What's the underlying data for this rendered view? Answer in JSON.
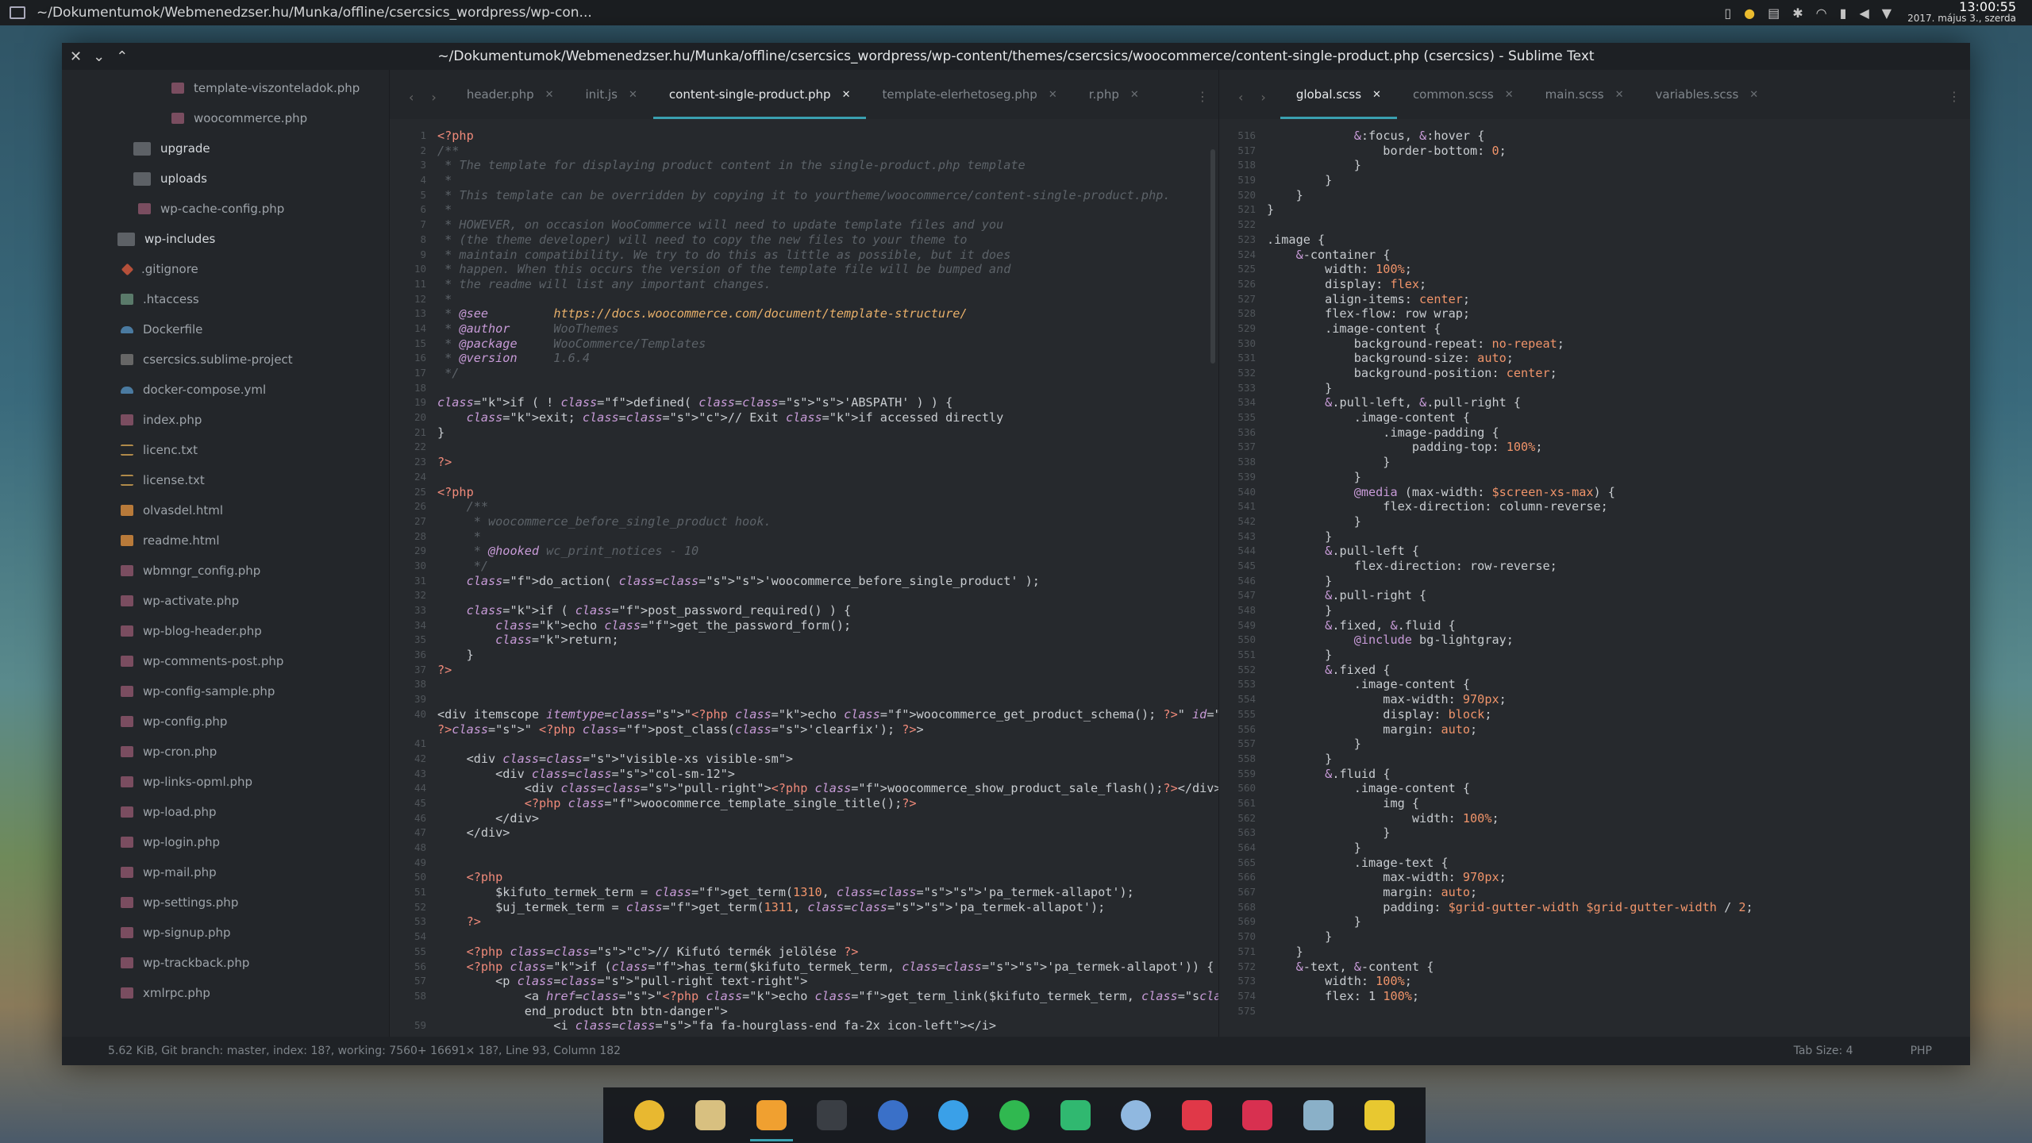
{
  "top_panel": {
    "title": "~/Dokumentumok/Webmenedzser.hu/Munka/offline/csercsics_wordpress/wp-con...",
    "time": "13:00:55",
    "date": "2017. május 3., szerda"
  },
  "window": {
    "title": "~/Dokumentumok/Webmenedzser.hu/Munka/offline/csercsics_wordpress/wp-content/themes/csercsics/woocommerce/content-single-product.php (csercsics) - Sublime Text",
    "close": "✕",
    "minimize": "⌄",
    "maximize": "⌃"
  },
  "sidebar": {
    "items": [
      {
        "label": "template-viszonteladok.php",
        "icon": "php",
        "indent": 120
      },
      {
        "label": "woocommerce.php",
        "icon": "php",
        "indent": 120
      },
      {
        "label": "upgrade",
        "icon": "folder",
        "indent": 72,
        "folder": true
      },
      {
        "label": "uploads",
        "icon": "folder",
        "indent": 72,
        "folder": true
      },
      {
        "label": "wp-cache-config.php",
        "icon": "php",
        "indent": 78
      },
      {
        "label": "wp-includes",
        "icon": "folder",
        "indent": 52,
        "folder": true
      },
      {
        "label": ".gitignore",
        "icon": "git",
        "indent": 56
      },
      {
        "label": ".htaccess",
        "icon": "htaccess",
        "indent": 56
      },
      {
        "label": "Dockerfile",
        "icon": "docker",
        "indent": 56
      },
      {
        "label": "csercsics.sublime-project",
        "icon": "proj",
        "indent": 56
      },
      {
        "label": "docker-compose.yml",
        "icon": "docker",
        "indent": 56
      },
      {
        "label": "index.php",
        "icon": "php",
        "indent": 56
      },
      {
        "label": "licenc.txt",
        "icon": "txt",
        "indent": 56
      },
      {
        "label": "license.txt",
        "icon": "txt",
        "indent": 56
      },
      {
        "label": "olvasdel.html",
        "icon": "html",
        "indent": 56
      },
      {
        "label": "readme.html",
        "icon": "html",
        "indent": 56
      },
      {
        "label": "wbmngr_config.php",
        "icon": "php",
        "indent": 56
      },
      {
        "label": "wp-activate.php",
        "icon": "php",
        "indent": 56
      },
      {
        "label": "wp-blog-header.php",
        "icon": "php",
        "indent": 56
      },
      {
        "label": "wp-comments-post.php",
        "icon": "php",
        "indent": 56
      },
      {
        "label": "wp-config-sample.php",
        "icon": "php",
        "indent": 56
      },
      {
        "label": "wp-config.php",
        "icon": "php",
        "indent": 56
      },
      {
        "label": "wp-cron.php",
        "icon": "php",
        "indent": 56
      },
      {
        "label": "wp-links-opml.php",
        "icon": "php",
        "indent": 56
      },
      {
        "label": "wp-load.php",
        "icon": "php",
        "indent": 56
      },
      {
        "label": "wp-login.php",
        "icon": "php",
        "indent": 56
      },
      {
        "label": "wp-mail.php",
        "icon": "php",
        "indent": 56
      },
      {
        "label": "wp-settings.php",
        "icon": "php",
        "indent": 56
      },
      {
        "label": "wp-signup.php",
        "icon": "php",
        "indent": 56
      },
      {
        "label": "wp-trackback.php",
        "icon": "php",
        "indent": 56
      },
      {
        "label": "xmlrpc.php",
        "icon": "php",
        "indent": 56
      }
    ]
  },
  "left_tabs": [
    {
      "label": "header.php",
      "active": false
    },
    {
      "label": "init.js",
      "active": false
    },
    {
      "label": "content-single-product.php",
      "active": true
    },
    {
      "label": "template-elerhetoseg.php",
      "active": false
    },
    {
      "label": "r.php",
      "active": false
    }
  ],
  "right_tabs": [
    {
      "label": "global.scss",
      "active": true
    },
    {
      "label": "common.scss",
      "active": false
    },
    {
      "label": "main.scss",
      "active": false
    },
    {
      "label": "variables.scss",
      "active": false
    }
  ],
  "left_code": {
    "start_line": 1,
    "lines": [
      "<?php",
      "/**",
      " * The template for displaying product content in the single-product.php template",
      " *",
      " * This template can be overridden by copying it to yourtheme/woocommerce/content-single-product.php.",
      " *",
      " * HOWEVER, on occasion WooCommerce will need to update template files and you",
      " * (the theme developer) will need to copy the new files to your theme to",
      " * maintain compatibility. We try to do this as little as possible, but it does",
      " * happen. When this occurs the version of the template file will be bumped and",
      " * the readme will list any important changes.",
      " *",
      " * @see         https://docs.woocommerce.com/document/template-structure/",
      " * @author      WooThemes",
      " * @package     WooCommerce/Templates",
      " * @version     1.6.4",
      " */",
      "",
      "if ( ! defined( 'ABSPATH' ) ) {",
      "    exit; // Exit if accessed directly",
      "}",
      "",
      "?>",
      "",
      "<?php",
      "    /**",
      "     * woocommerce_before_single_product hook.",
      "     *",
      "     * @hooked wc_print_notices - 10",
      "     */",
      "    do_action( 'woocommerce_before_single_product' );",
      "",
      "    if ( post_password_required() ) {",
      "        echo get_the_password_form();",
      "        return;",
      "    }",
      "?>",
      "",
      "",
      "<div itemscope itemtype=\"<?php echo woocommerce_get_product_schema(); ?>\" id=\"product-<?php the_ID();",
      "?>\" <?php post_class('clearfix'); ?>>",
      "",
      "    <div class=\"visible-xs visible-sm\">",
      "        <div class=\"col-sm-12\">",
      "            <div class=\"pull-right\"><?php woocommerce_show_product_sale_flash();?></div>",
      "            <?php woocommerce_template_single_title();?>",
      "        </div>",
      "    </div>",
      "",
      "",
      "    <?php",
      "        $kifuto_termek_term = get_term(1310, 'pa_termek-allapot');",
      "        $uj_termek_term = get_term(1311, 'pa_termek-allapot');",
      "    ?>",
      "",
      "    <?php // Kifutó termék jelölése ?>",
      "    <?php if (has_term($kifuto_termek_term, 'pa_termek-allapot')) { ?>",
      "        <p class=\"pull-right text-right\">",
      "            <a href=\"<?php echo get_term_link($kifuto_termek_term, 'pa_termek-allapot');?>\" class=\"",
      "            end_product btn btn-danger\">",
      "                <i class=\"fa fa-hourglass-end fa-2x icon-left\"></i>"
    ],
    "gutter": [
      "1",
      "2",
      "3",
      "4",
      "5",
      "6",
      "7",
      "8",
      "9",
      "10",
      "11",
      "12",
      "13",
      "14",
      "15",
      "16",
      "17",
      "18",
      "19",
      "20",
      "21",
      "22",
      "23",
      "24",
      "25",
      "26",
      "27",
      "28",
      "29",
      "30",
      "31",
      "32",
      "33",
      "34",
      "35",
      "36",
      "37",
      "38",
      "39",
      "40",
      "",
      "41",
      "42",
      "43",
      "44",
      "45",
      "46",
      "47",
      "48",
      "49",
      "50",
      "51",
      "52",
      "53",
      "54",
      "55",
      "56",
      "57",
      "58",
      "",
      "59"
    ]
  },
  "right_code": {
    "lines": [
      "            &:focus, &:hover {",
      "                border-bottom: 0;",
      "            }",
      "        }",
      "    }",
      "}",
      "",
      ".image {",
      "    &-container {",
      "        width: 100%;",
      "        display: flex;",
      "        align-items: center;",
      "        flex-flow: row wrap;",
      "        .image-content {",
      "            background-repeat: no-repeat;",
      "            background-size: auto;",
      "            background-position: center;",
      "        }",
      "        &.pull-left, &.pull-right {",
      "            .image-content {",
      "                .image-padding {",
      "                    padding-top: 100%;",
      "                }",
      "            }",
      "            @media (max-width: $screen-xs-max) {",
      "                flex-direction: column-reverse;",
      "            }",
      "        }",
      "        &.pull-left {",
      "            flex-direction: row-reverse;",
      "        }",
      "        &.pull-right {",
      "        }",
      "        &.fixed, &.fluid {",
      "            @include bg-lightgray;",
      "        }",
      "        &.fixed {",
      "            .image-content {",
      "                max-width: 970px;",
      "                display: block;",
      "                margin: auto;",
      "            }",
      "        }",
      "        &.fluid {",
      "            .image-content {",
      "                img {",
      "                    width: 100%;",
      "                }",
      "            }",
      "            .image-text {",
      "                max-width: 970px;",
      "                margin: auto;",
      "                padding: $grid-gutter-width $grid-gutter-width / 2;",
      "            }",
      "        }",
      "    }",
      "    &-text, &-content {",
      "        width: 100%;",
      "        flex: 1 100%;"
    ],
    "gutter": [
      "516",
      "517",
      "518",
      "519",
      "520",
      "521",
      "522",
      "523",
      "524",
      "525",
      "526",
      "527",
      "528",
      "529",
      "530",
      "531",
      "532",
      "533",
      "534",
      "535",
      "536",
      "537",
      "538",
      "539",
      "540",
      "541",
      "542",
      "543",
      "544",
      "545",
      "546",
      "547",
      "548",
      "549",
      "550",
      "551",
      "552",
      "553",
      "554",
      "555",
      "556",
      "557",
      "558",
      "559",
      "560",
      "561",
      "562",
      "563",
      "564",
      "565",
      "566",
      "567",
      "568",
      "569",
      "570",
      "571",
      "572",
      "573",
      "574",
      "575"
    ]
  },
  "statusbar": {
    "message": "5.62 KiB, Git branch: master, index: 18?, working: 7560+ 16691× 18?, Line 93, Column 182",
    "tab_size": "Tab Size: 4",
    "syntax": "PHP"
  },
  "dock": {
    "icons": [
      {
        "name": "chrome-icon",
        "color": "#e8b830"
      },
      {
        "name": "files-icon",
        "color": "#d8c080"
      },
      {
        "name": "sublime-text-icon",
        "color": "#f0a030"
      },
      {
        "name": "terminal-icon",
        "color": "#3a3e44"
      },
      {
        "name": "qbittorrent-icon",
        "color": "#3a70c8"
      },
      {
        "name": "sync-icon",
        "color": "#3aa0e8"
      },
      {
        "name": "spotify-icon",
        "color": "#30b850"
      },
      {
        "name": "hangups-icon",
        "color": "#30b870"
      },
      {
        "name": "pidgin-icon",
        "color": "#90b8e0"
      },
      {
        "name": "pocket-icon",
        "color": "#e03848"
      },
      {
        "name": "puzzle-icon",
        "color": "#d83050"
      },
      {
        "name": "calculator-icon",
        "color": "#8ab0c8"
      },
      {
        "name": "skype-like-icon",
        "color": "#e8c830"
      }
    ]
  }
}
